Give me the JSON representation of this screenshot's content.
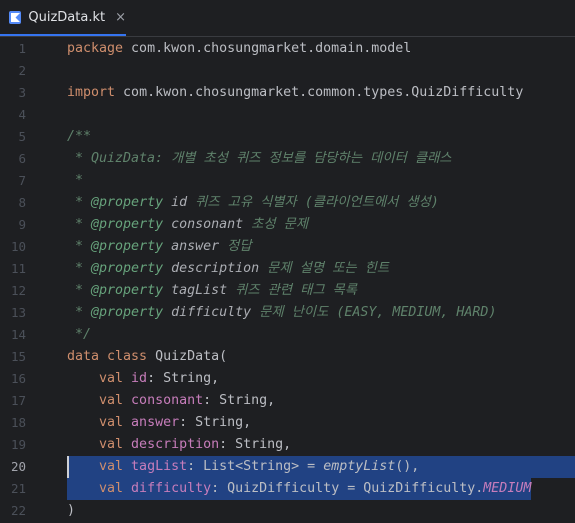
{
  "tab": {
    "label": "QuizData.kt",
    "close": "×",
    "icon": "kotlin-file-icon"
  },
  "line_numbers": [
    "1",
    "2",
    "3",
    "4",
    "5",
    "6",
    "7",
    "8",
    "9",
    "10",
    "11",
    "12",
    "13",
    "14",
    "15",
    "16",
    "17",
    "18",
    "19",
    "20",
    "21",
    "22"
  ],
  "current_line": "20",
  "code": {
    "l1_kw": "package",
    "l1_rest": " com.kwon.chosungmarket.domain.model",
    "l3_kw": "import",
    "l3_rest": " com.kwon.chosungmarket.common.types.QuizDifficulty",
    "l5": "/**",
    "l6": " * QuizData: 개별 초성 퀴즈 정보를 담당하는 데이터 클래스",
    "l7": " *",
    "l8_pre": " * ",
    "l8_tag": "@property",
    "l8_name": " id",
    "l8_desc": " 퀴즈 고유 식별자 (클라이언트에서 생성)",
    "l9_pre": " * ",
    "l9_tag": "@property",
    "l9_name": " consonant",
    "l9_desc": " 초성 문제",
    "l10_pre": " * ",
    "l10_tag": "@property",
    "l10_name": " answer",
    "l10_desc": " 정답",
    "l11_pre": " * ",
    "l11_tag": "@property",
    "l11_name": " description",
    "l11_desc": " 문제 설명 또는 힌트",
    "l12_pre": " * ",
    "l12_tag": "@property",
    "l12_name": " tagList",
    "l12_desc": " 퀴즈 관련 태그 목록",
    "l13_pre": " * ",
    "l13_tag": "@property",
    "l13_name": " difficulty",
    "l13_desc": " 문제 난이도 (EASY, MEDIUM, HARD)",
    "l14": " */",
    "l15_kw": "data class",
    "l15_rest": " QuizData(",
    "l16_kw": "    val",
    "l16_prop": " id",
    "l16_rest": ": String,",
    "l17_kw": "    val",
    "l17_prop": " consonant",
    "l17_rest": ": String,",
    "l18_kw": "    val",
    "l18_prop": " answer",
    "l18_rest": ": String,",
    "l19_kw": "    val",
    "l19_prop": " description",
    "l19_rest": ": String,",
    "l20_kw": "    val",
    "l20_prop": " tagList",
    "l20_mid": ": List<String> = ",
    "l20_fn": "emptyList",
    "l20_end": "(),",
    "l21_kw": "    val",
    "l21_prop": " difficulty",
    "l21_mid": ": QuizDifficulty = QuizDifficulty.",
    "l21_const": "MEDIUM",
    "l22": ")"
  },
  "colors": {
    "background": "#1e1f22",
    "keyword": "#cf8e6d",
    "property": "#c77dbb",
    "doc_comment": "#5f826b",
    "selection": "#214283",
    "tab_accent": "#3574f0"
  }
}
